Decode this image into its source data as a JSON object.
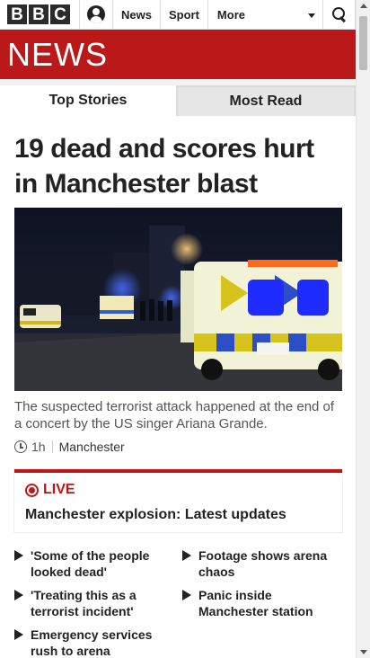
{
  "header": {
    "logo_letters": [
      "B",
      "B",
      "C"
    ],
    "nav": [
      {
        "label": "News"
      },
      {
        "label": "Sport"
      }
    ],
    "more_label": "More"
  },
  "banner": {
    "title": "NEWS"
  },
  "tabs": [
    {
      "label": "Top Stories",
      "active": true
    },
    {
      "label": "Most Read",
      "active": false
    }
  ],
  "story": {
    "headline": "19 dead and scores hurt in Manchester blast",
    "summary": "The suspected terrorist attack happened at the end of a concert by the US singer Ariana Grande.",
    "time": "1h",
    "tag": "Manchester"
  },
  "live": {
    "label": "LIVE",
    "title": "Manchester explosion: Latest updates"
  },
  "related": [
    {
      "title": "'Some of the people looked dead'"
    },
    {
      "title": "Footage shows arena chaos"
    },
    {
      "title": "'Treating this as a terrorist incident'"
    },
    {
      "title": "Panic inside Manchester station"
    },
    {
      "title": "Emergency services rush to arena"
    }
  ],
  "colors": {
    "brand_red": "#bb1919",
    "text": "#222222"
  }
}
